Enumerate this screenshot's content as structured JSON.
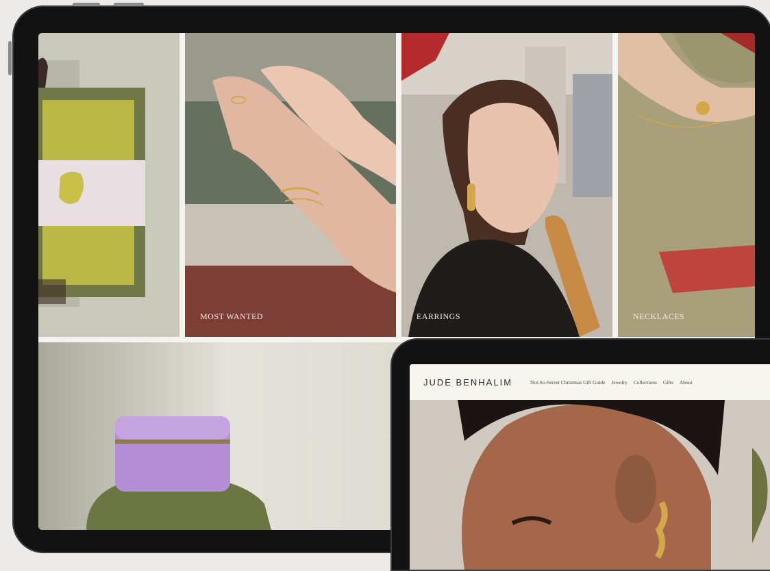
{
  "tiles": [
    {
      "label": ""
    },
    {
      "label": "MOST WANTED"
    },
    {
      "label": "EARRINGS"
    },
    {
      "label": "NECKLACES"
    }
  ],
  "site": {
    "brand": "JUDE BENHALIM",
    "nav": [
      "Not-So-Secret Christmas Gift Guide",
      "Jewelry",
      "Collections",
      "Gifts",
      "About"
    ]
  },
  "colors": {
    "frame": "#121212",
    "backdrop": "#ecebe9",
    "olive": "#6d7340",
    "lilac": "#b48ed6",
    "gold": "#d2a84a"
  }
}
